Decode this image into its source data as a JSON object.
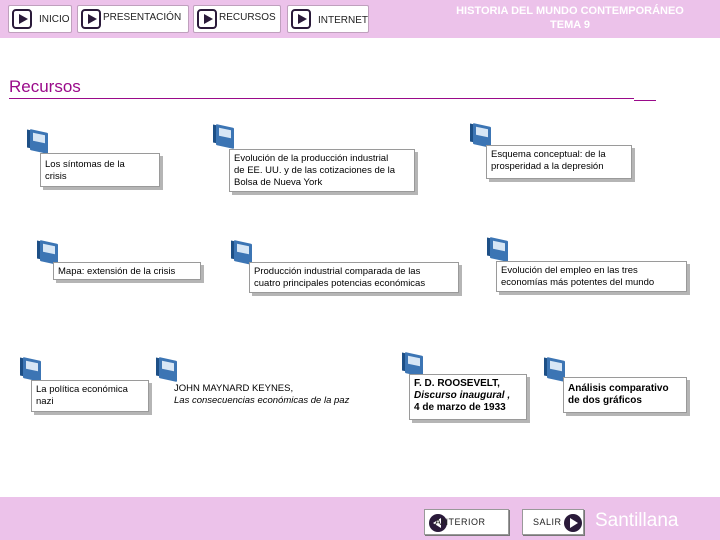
{
  "nav": {
    "inicio": "INICIO",
    "presentacion": "PRESENTACIÓN",
    "recursos": "RECURSOS",
    "internet": "INTERNET"
  },
  "header": {
    "line1": "HISTORIA DEL MUNDO CONTEMPORÁNEO",
    "line2": "TEMA 9"
  },
  "section_title": "Recursos",
  "resources": {
    "r1": {
      "l1": "Los síntomas de la",
      "l2": "crisis"
    },
    "r2": {
      "l1": "Evolución de la producción industrial",
      "l2": "de EE. UU. y de las cotizaciones de la",
      "l3": "Bolsa de Nueva York"
    },
    "r3": {
      "l1": "Esquema conceptual: de la",
      "l2": "prosperidad a la depresión"
    },
    "r4": {
      "l1": "Mapa: extensión de la crisis"
    },
    "r5": {
      "l1": "Producción industrial comparada de las",
      "l2": "cuatro principales potencias económicas"
    },
    "r6": {
      "l1": "Evolución del empleo en las tres",
      "l2": "economías más potentes del mundo"
    },
    "r7": {
      "l1": "La política económica",
      "l2": "nazi"
    },
    "r8": {
      "l1": "JOHN MAYNARD KEYNES,",
      "l2": "Las consecuencias económicas de la paz"
    },
    "r9": {
      "l1": "F. D. ROOSEVELT,",
      "l2": "Discurso inaugural ,",
      "l3": "4 de marzo de 1933"
    },
    "r10": {
      "l1": "Análisis comparativo",
      "l2": "de dos gráficos"
    }
  },
  "footer": {
    "anterior": "ANTERIOR",
    "salir": "SALIR",
    "brand": "Santillana"
  },
  "colors": {
    "bar": "#ecc2ea",
    "accent": "#9a0a8a",
    "icon": "#3c75b4"
  }
}
